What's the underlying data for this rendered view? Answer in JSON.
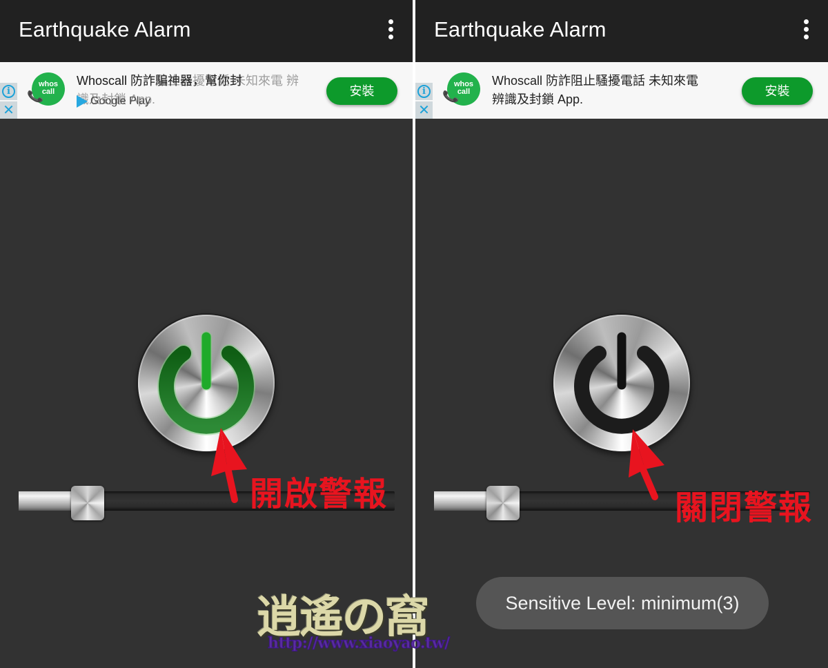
{
  "screens": [
    {
      "id": "left",
      "app_title": "Earthquake Alarm",
      "overflow_icon": "more-vert-icon",
      "ad": {
        "info_icon": "info-icon",
        "close_icon": "close-icon",
        "logo_text_line1": "whos",
        "logo_text_line2": "call",
        "headline": "Whoscall 防詐騙神器，幫你封",
        "ghost_text": "Whoscall 防詐阻止騷擾電話 未知來電 辨識及封鎖 App.",
        "store_label": "Google Play",
        "install_label": "安裝"
      },
      "power": {
        "state": "on",
        "color": "#1f8f2a"
      },
      "slider": {
        "value_fraction": 0.14
      },
      "annotation": "開啟警報",
      "annotation_color": "#e8141f"
    },
    {
      "id": "right",
      "app_title": "Earthquake Alarm",
      "overflow_icon": "more-vert-icon",
      "ad": {
        "info_icon": "info-icon",
        "close_icon": "close-icon",
        "logo_text_line1": "whos",
        "logo_text_line2": "call",
        "headline": "Whoscall 防詐阻止騷擾電話 未知來電",
        "headline_line2": "辨識及封鎖 App.",
        "install_label": "安裝"
      },
      "power": {
        "state": "off",
        "color": "#1c1c1c"
      },
      "slider": {
        "value_fraction": 0.14
      },
      "annotation": "關閉警報",
      "annotation_color": "#e8141f",
      "toast": "Sensitive Level: minimum(3)"
    }
  ],
  "watermark": {
    "title": "逍遙の窩",
    "url": "http://www.xiaoyao.tw/"
  },
  "colors": {
    "appbar": "#212121",
    "background": "#323232",
    "install_button": "#0d9a2b",
    "annotation": "#e8141f"
  }
}
